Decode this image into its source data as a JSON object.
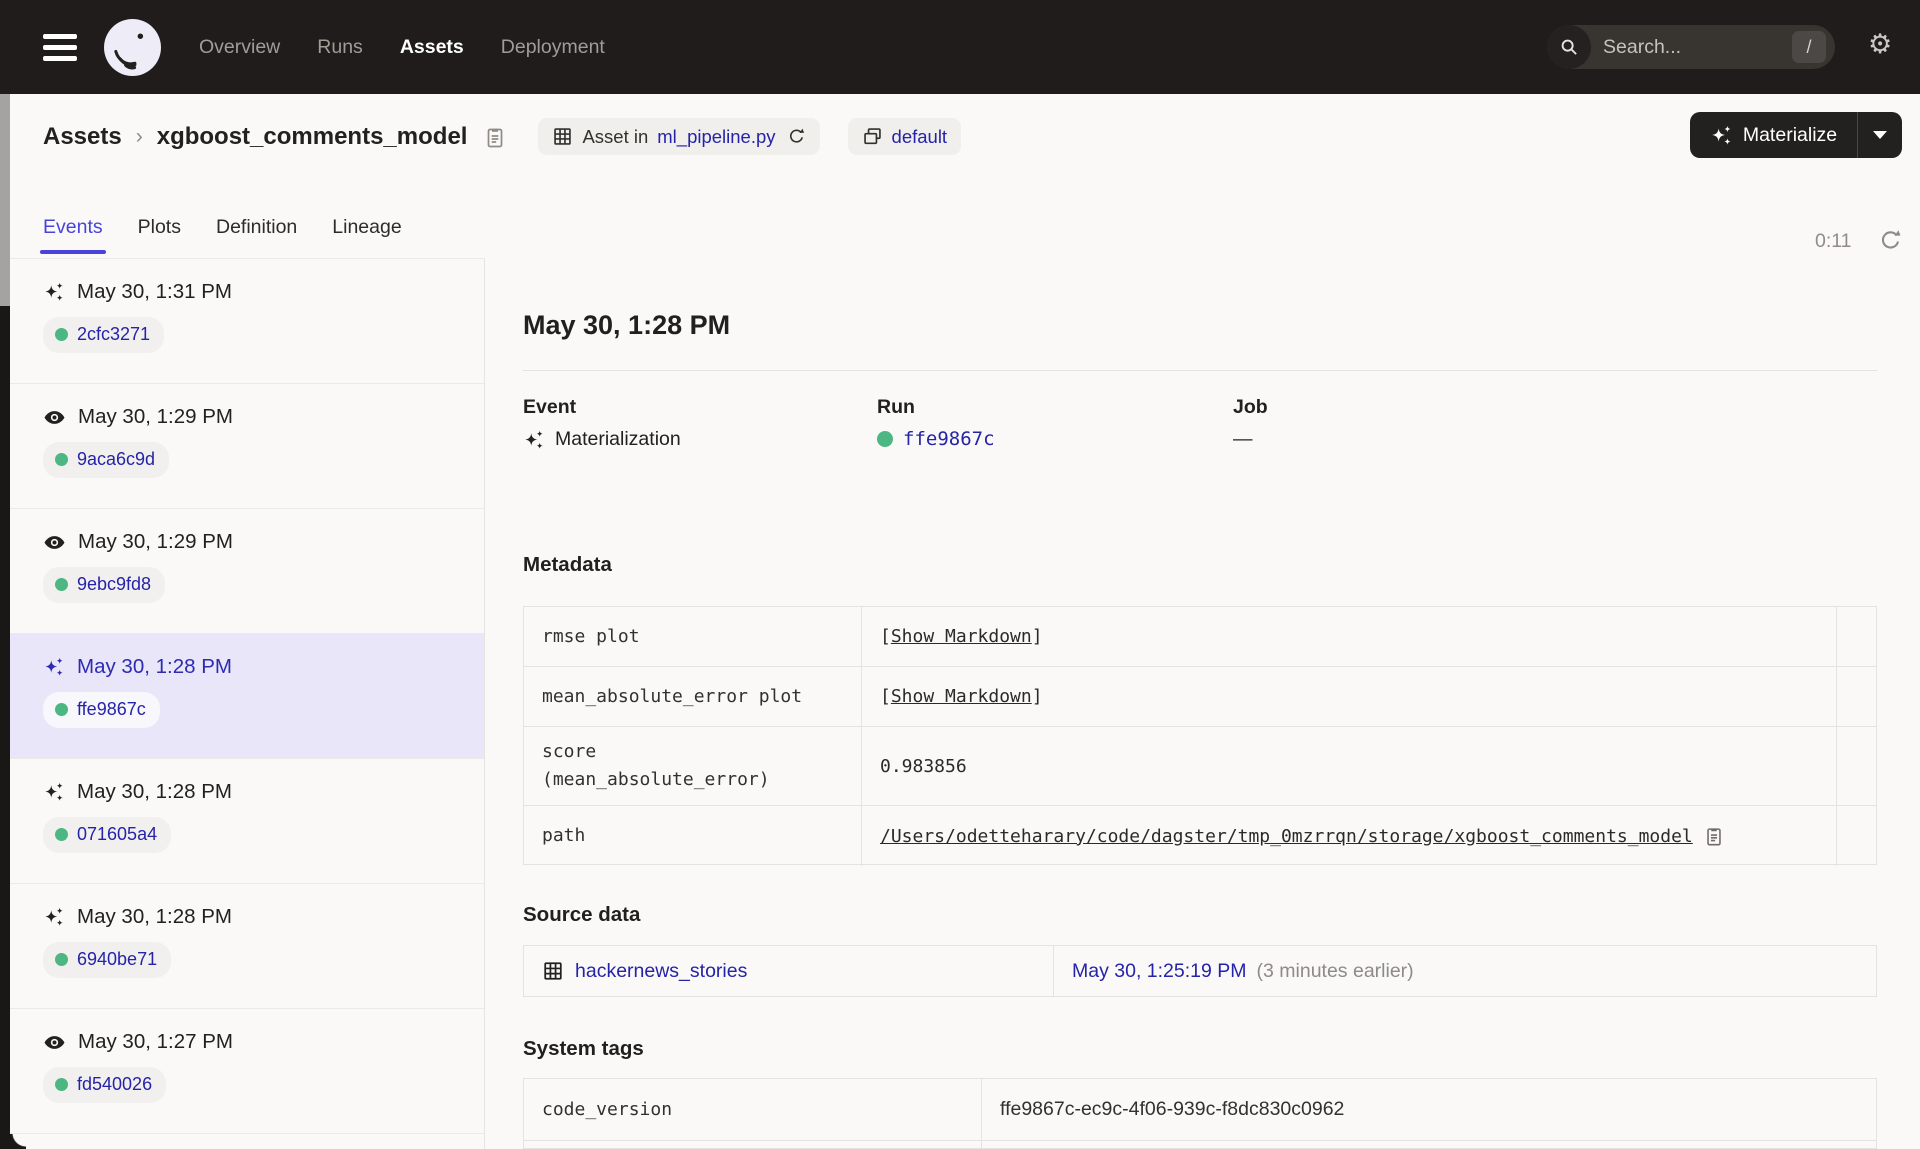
{
  "nav": {
    "items": [
      {
        "label": "Overview",
        "active": false
      },
      {
        "label": "Runs",
        "active": false
      },
      {
        "label": "Assets",
        "active": true
      },
      {
        "label": "Deployment",
        "active": false
      }
    ],
    "search": {
      "placeholder": "Search...",
      "shortcut": "/"
    }
  },
  "header": {
    "breadcrumb_root": "Assets",
    "breadcrumb_sep": "›",
    "asset_name": "xgboost_comments_model",
    "asset_in_label": "Asset in",
    "asset_file": "ml_pipeline.py",
    "group_badge": "default",
    "materialize_label": "Materialize"
  },
  "tabs": {
    "items": [
      {
        "label": "Events",
        "active": true
      },
      {
        "label": "Plots",
        "active": false
      },
      {
        "label": "Definition",
        "active": false
      },
      {
        "label": "Lineage",
        "active": false
      }
    ],
    "timer": "0:11"
  },
  "sidebar": {
    "events": [
      {
        "icon": "sparkle-icon",
        "time": "May 30, 1:31 PM",
        "run_id": "2cfc3271",
        "selected": false
      },
      {
        "icon": "eye-icon",
        "time": "May 30, 1:29 PM",
        "run_id": "9aca6c9d",
        "selected": false
      },
      {
        "icon": "eye-icon",
        "time": "May 30, 1:29 PM",
        "run_id": "9ebc9fd8",
        "selected": false
      },
      {
        "icon": "sparkle-icon",
        "time": "May 30, 1:28 PM",
        "run_id": "ffe9867c",
        "selected": true
      },
      {
        "icon": "sparkle-icon",
        "time": "May 30, 1:28 PM",
        "run_id": "071605a4",
        "selected": false
      },
      {
        "icon": "sparkle-icon",
        "time": "May 30, 1:28 PM",
        "run_id": "6940be71",
        "selected": false
      },
      {
        "icon": "eye-icon",
        "time": "May 30, 1:27 PM",
        "run_id": "fd540026",
        "selected": false
      }
    ]
  },
  "detail": {
    "title": "May 30, 1:28 PM",
    "event_label": "Event",
    "event_value": "Materialization",
    "run_label": "Run",
    "run_value": "ffe9867c",
    "job_label": "Job",
    "job_value": "—",
    "metadata": {
      "heading": "Metadata",
      "rows": [
        {
          "key": "rmse plot",
          "kind": "markdown",
          "value_display": "[Show Markdown]",
          "link": "Show Markdown"
        },
        {
          "key": "mean_absolute_error plot",
          "kind": "markdown",
          "value_display": "[Show Markdown]",
          "link": "Show Markdown"
        },
        {
          "key": "score\n(mean_absolute_error)",
          "kind": "text",
          "value_display": "0.983856"
        },
        {
          "key": "path",
          "kind": "path",
          "value_display": "/Users/odetteharary/code/dagster/tmp_0mzrrqn/storage/xgboost_comments_model"
        }
      ]
    },
    "source_data": {
      "heading": "Source data",
      "asset": "hackernews_stories",
      "timestamp": "May 30, 1:25:19 PM",
      "relative": "(3 minutes earlier)"
    },
    "system_tags": {
      "heading": "System tags",
      "rows": [
        {
          "key": "code_version",
          "value": "ffe9867c-ec9c-4f06-939c-f8dc830c0962"
        }
      ]
    }
  },
  "colors": {
    "nav_bg": "#1f1c1b",
    "page_bg": "#faf9f7",
    "accent": "#4843dc",
    "link": "#2523a8",
    "success_green": "#4cb782",
    "selected_row_bg": "#e8e6f8",
    "button_bg": "#232120"
  }
}
